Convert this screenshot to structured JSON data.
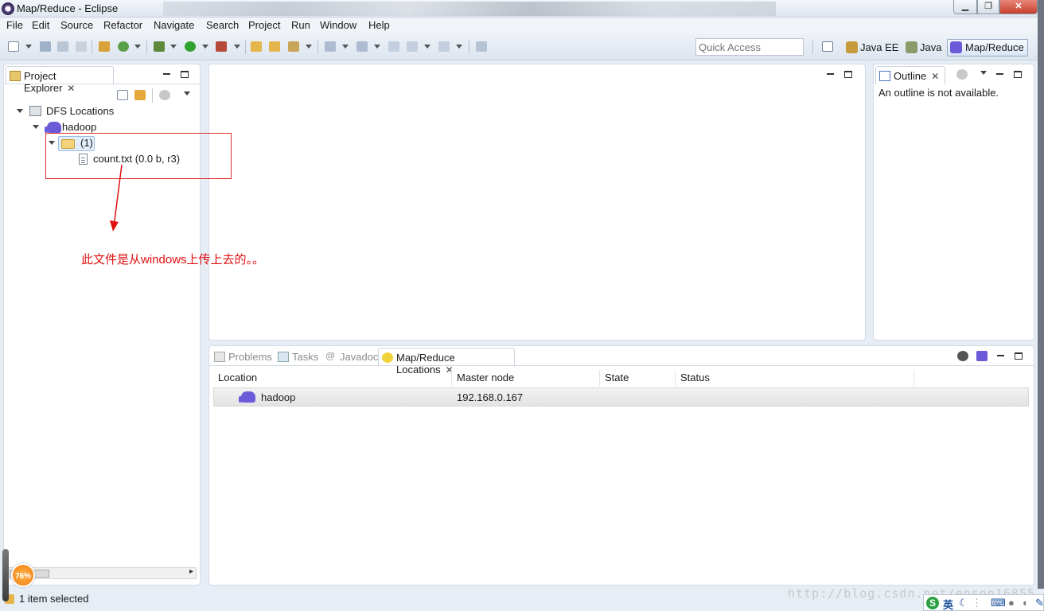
{
  "window": {
    "title": "Map/Reduce - Eclipse",
    "min_glyph": "▁",
    "max_glyph": "❐",
    "close_glyph": "✕"
  },
  "menu": [
    "File",
    "Edit",
    "Source",
    "Refactor",
    "Navigate",
    "Search",
    "Project",
    "Run",
    "Window",
    "Help"
  ],
  "toolbar": {
    "quick_access_placeholder": "Quick Access"
  },
  "perspectives": [
    {
      "label": "Java EE",
      "icon": "java-ee-icon"
    },
    {
      "label": "Java",
      "icon": "java-icon"
    },
    {
      "label": "Map/Reduce",
      "icon": "elephant-icon",
      "active": true
    }
  ],
  "project_explorer": {
    "tab_label": "Project Explorer",
    "tree": {
      "root": "DFS Locations",
      "location": "hadoop",
      "folder": "(1)",
      "file": "count.txt (0.0 b, r3)"
    }
  },
  "outline": {
    "tab_label": "Outline",
    "message": "An outline is not available."
  },
  "bottom_tabs": [
    {
      "label": "Problems",
      "icon": "problems-icon",
      "active": false
    },
    {
      "label": "Tasks",
      "icon": "tasks-icon",
      "active": false
    },
    {
      "label": "Javadoc",
      "icon": "javadoc-icon",
      "active": false
    },
    {
      "label": "Map/Reduce Locations",
      "icon": "mapreduce-icon",
      "active": true
    }
  ],
  "locations_table": {
    "columns": [
      "Location",
      "Master node",
      "State",
      "Status"
    ],
    "rows": [
      {
        "location": "hadoop",
        "master_node": "192.168.0.167",
        "state": "",
        "status": ""
      }
    ]
  },
  "annotation": {
    "text": "此文件是从windows上传上去的。。",
    "color": "#e01010"
  },
  "status": {
    "text": "1 item selected",
    "badge": "76%"
  },
  "watermark": "http://blog.csdn.net/enson16855",
  "ime": {
    "s": "S",
    "lang": "英"
  },
  "colors": {
    "accent": "#6b5bd8",
    "annotation": "#e03030"
  }
}
